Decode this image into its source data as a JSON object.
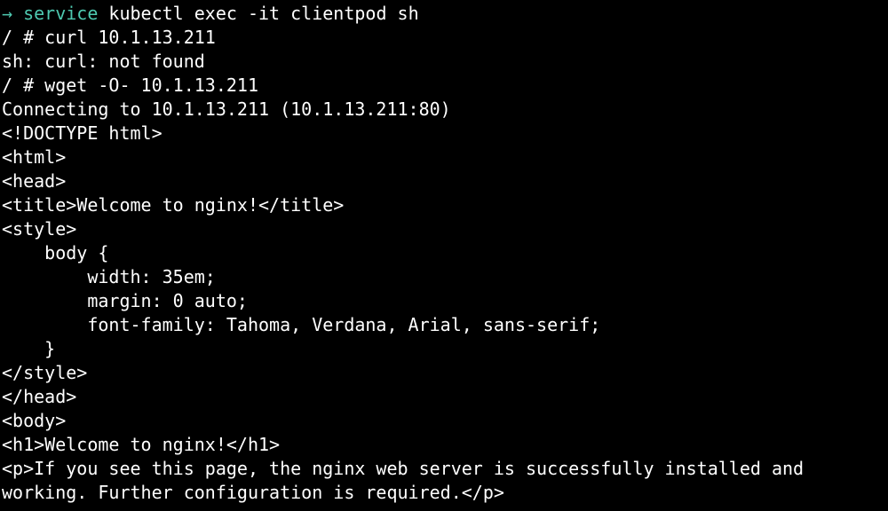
{
  "lines": {
    "l0_prefix": "→ ",
    "l0_dir": "service",
    "l0_cmd": " kubectl exec -it clientpod sh",
    "l1": "/ # curl 10.1.13.211",
    "l2": "sh: curl: not found",
    "l3": "/ # wget -O- 10.1.13.211",
    "l4": "Connecting to 10.1.13.211 (10.1.13.211:80)",
    "l5": "<!DOCTYPE html>",
    "l6": "<html>",
    "l7": "<head>",
    "l8": "<title>Welcome to nginx!</title>",
    "l9": "<style>",
    "l10": "    body {",
    "l11": "        width: 35em;",
    "l12": "        margin: 0 auto;",
    "l13": "        font-family: Tahoma, Verdana, Arial, sans-serif;",
    "l14": "    }",
    "l15": "</style>",
    "l16": "</head>",
    "l17": "<body>",
    "l18": "<h1>Welcome to nginx!</h1>",
    "l19": "<p>If you see this page, the nginx web server is successfully installed and",
    "l20": "working. Further configuration is required.</p>"
  }
}
